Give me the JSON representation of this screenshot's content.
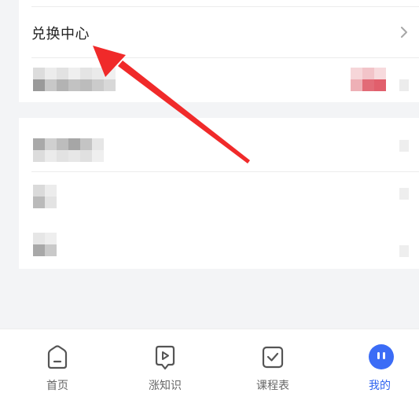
{
  "redeem_center": {
    "label": "兑换中心"
  },
  "tabbar": {
    "tabs": [
      {
        "label": "首页",
        "icon": "home-icon"
      },
      {
        "label": "涨知识",
        "icon": "play-icon"
      },
      {
        "label": "课程表",
        "icon": "checkbox-icon"
      },
      {
        "label": "我的",
        "icon": "profile-icon"
      }
    ],
    "active_index": 3
  },
  "colors": {
    "accent": "#3b6cf6",
    "active_text": "#2e63f0",
    "annotation_arrow": "#f02a2a",
    "background": "#f3f4f6"
  }
}
